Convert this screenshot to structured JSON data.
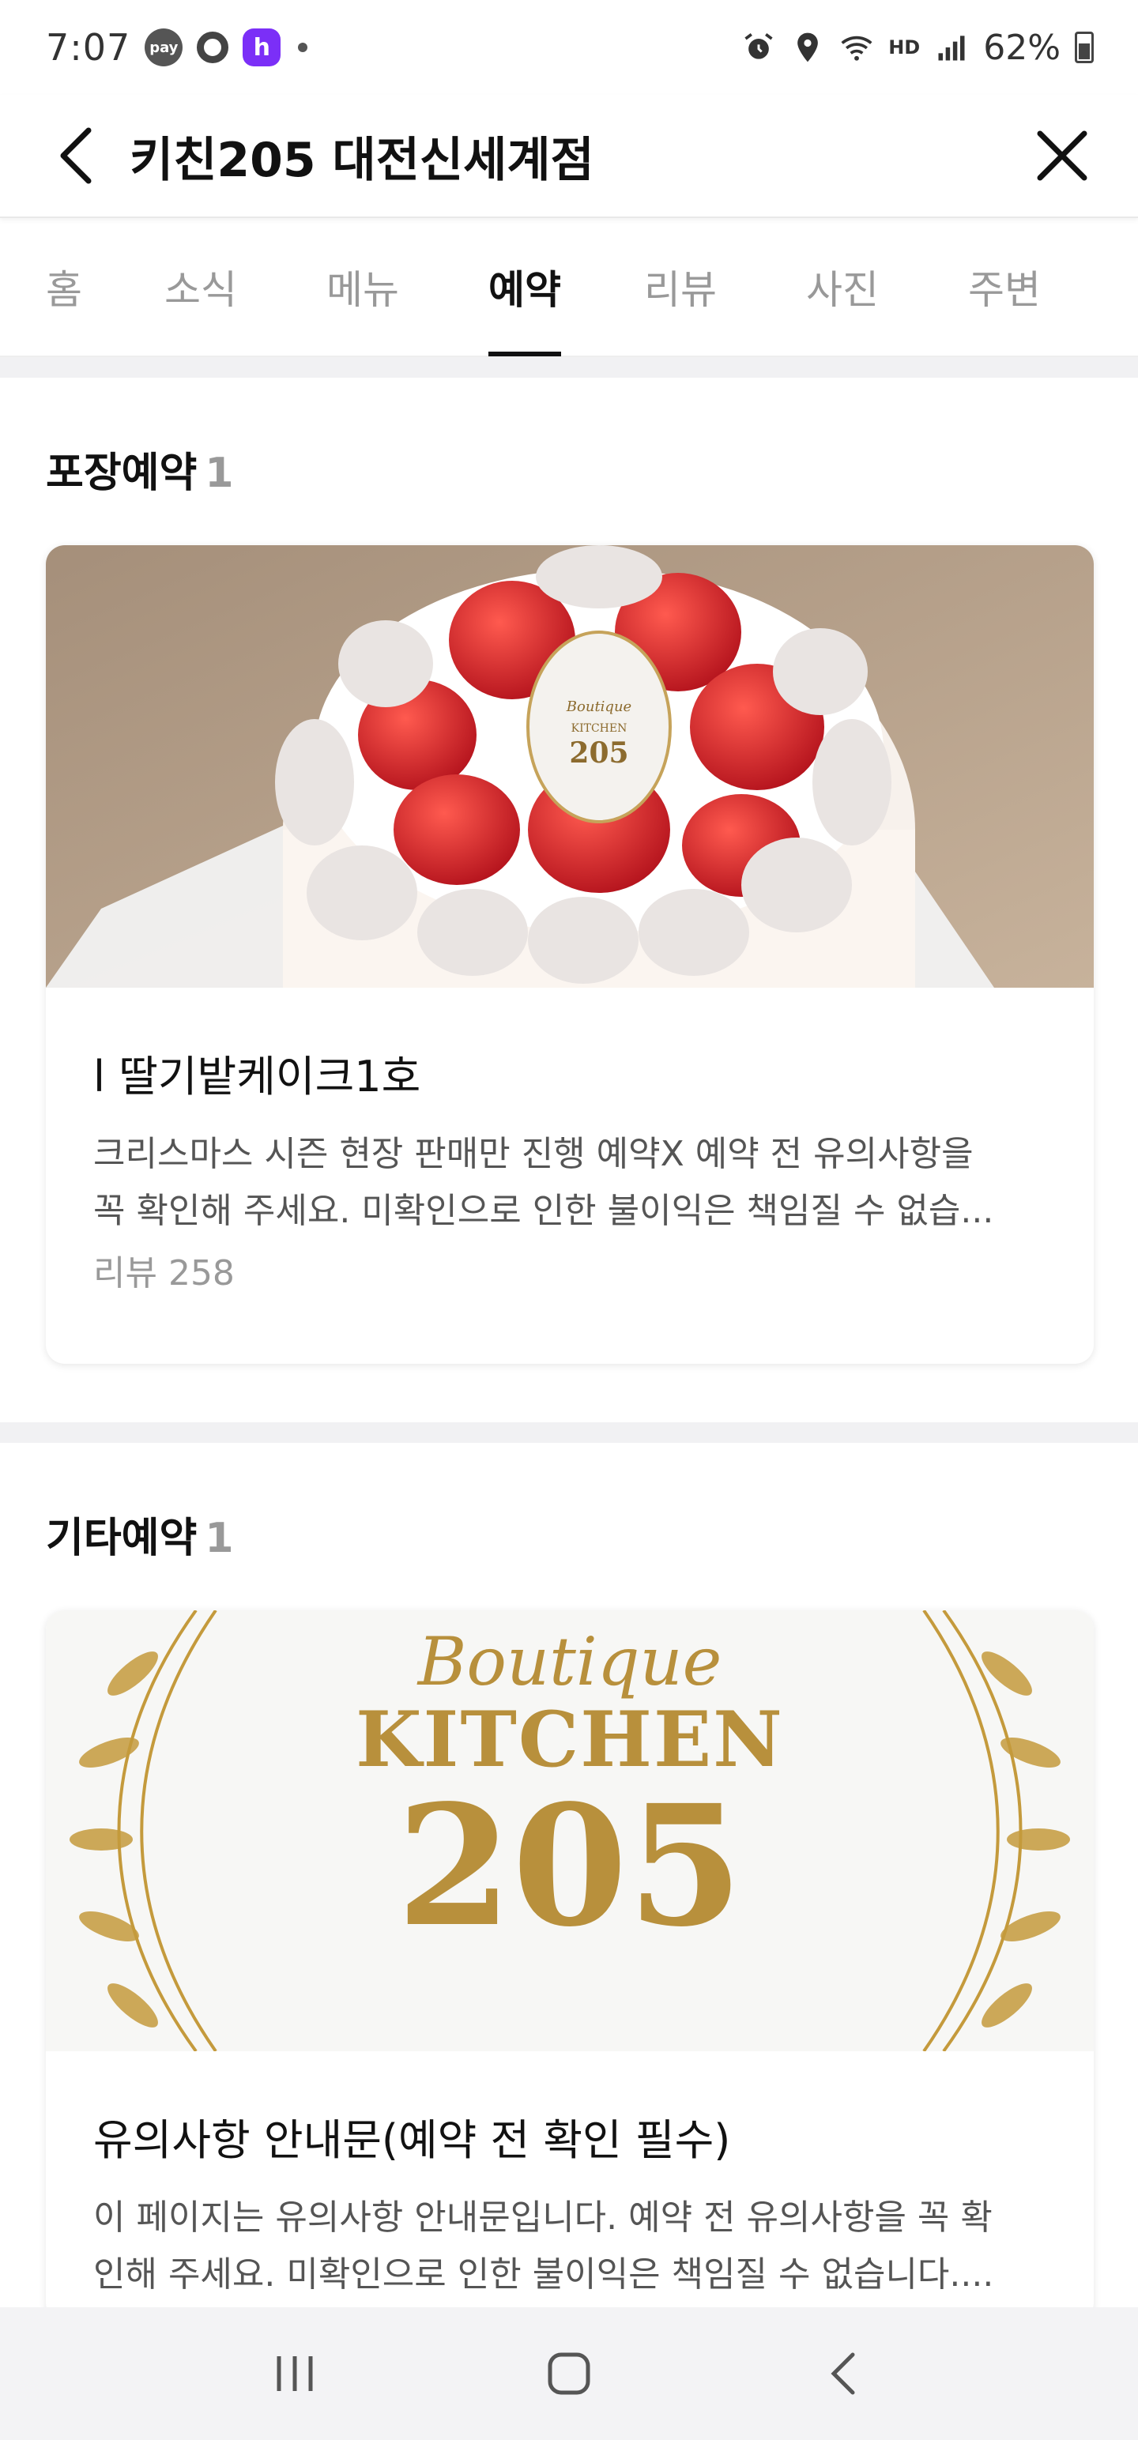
{
  "status_bar": {
    "time": "7:07",
    "pay_badge": "pay",
    "h_badge": "h",
    "battery_text": "62%",
    "hd_label": "HD"
  },
  "header": {
    "title": "키친205 대전신세계점"
  },
  "tabs": [
    {
      "label": "홈",
      "active": false
    },
    {
      "label": "소식",
      "active": false
    },
    {
      "label": "메뉴",
      "active": false
    },
    {
      "label": "예약",
      "active": true
    },
    {
      "label": "리뷰",
      "active": false
    },
    {
      "label": "사진",
      "active": false
    },
    {
      "label": "주변",
      "active": false
    }
  ],
  "sections": [
    {
      "title": "포장예약",
      "count": "1",
      "card": {
        "title": "l 딸기밭케이크1호",
        "desc_line1": "크리스마스 시즌 현장 판매만 진행 예약X 예약 전 유의사항을",
        "desc_line2": "꼭 확인해 주세요. 미확인으로 인한 불이익은 책임질 수 없습...",
        "meta": "리뷰 258",
        "image_label": "Boutique KITCHEN 205"
      }
    },
    {
      "title": "기타예약",
      "count": "1",
      "card": {
        "title": "유의사항 안내문(예약 전 확인 필수)",
        "desc_line1": "이 페이지는 유의사항 안내문입니다. 예약 전 유의사항을 꼭 확",
        "desc_line2": "인해 주세요. 미확인으로 인한 불이익은 책임질 수 없습니다....",
        "logo": {
          "line1": "Boutique",
          "line2": "KITCHEN",
          "line3": "205"
        }
      }
    }
  ],
  "colors": {
    "accent": "#111111",
    "muted": "#999999",
    "gold": "#b8903c",
    "strawberry": "#d62a2a"
  }
}
